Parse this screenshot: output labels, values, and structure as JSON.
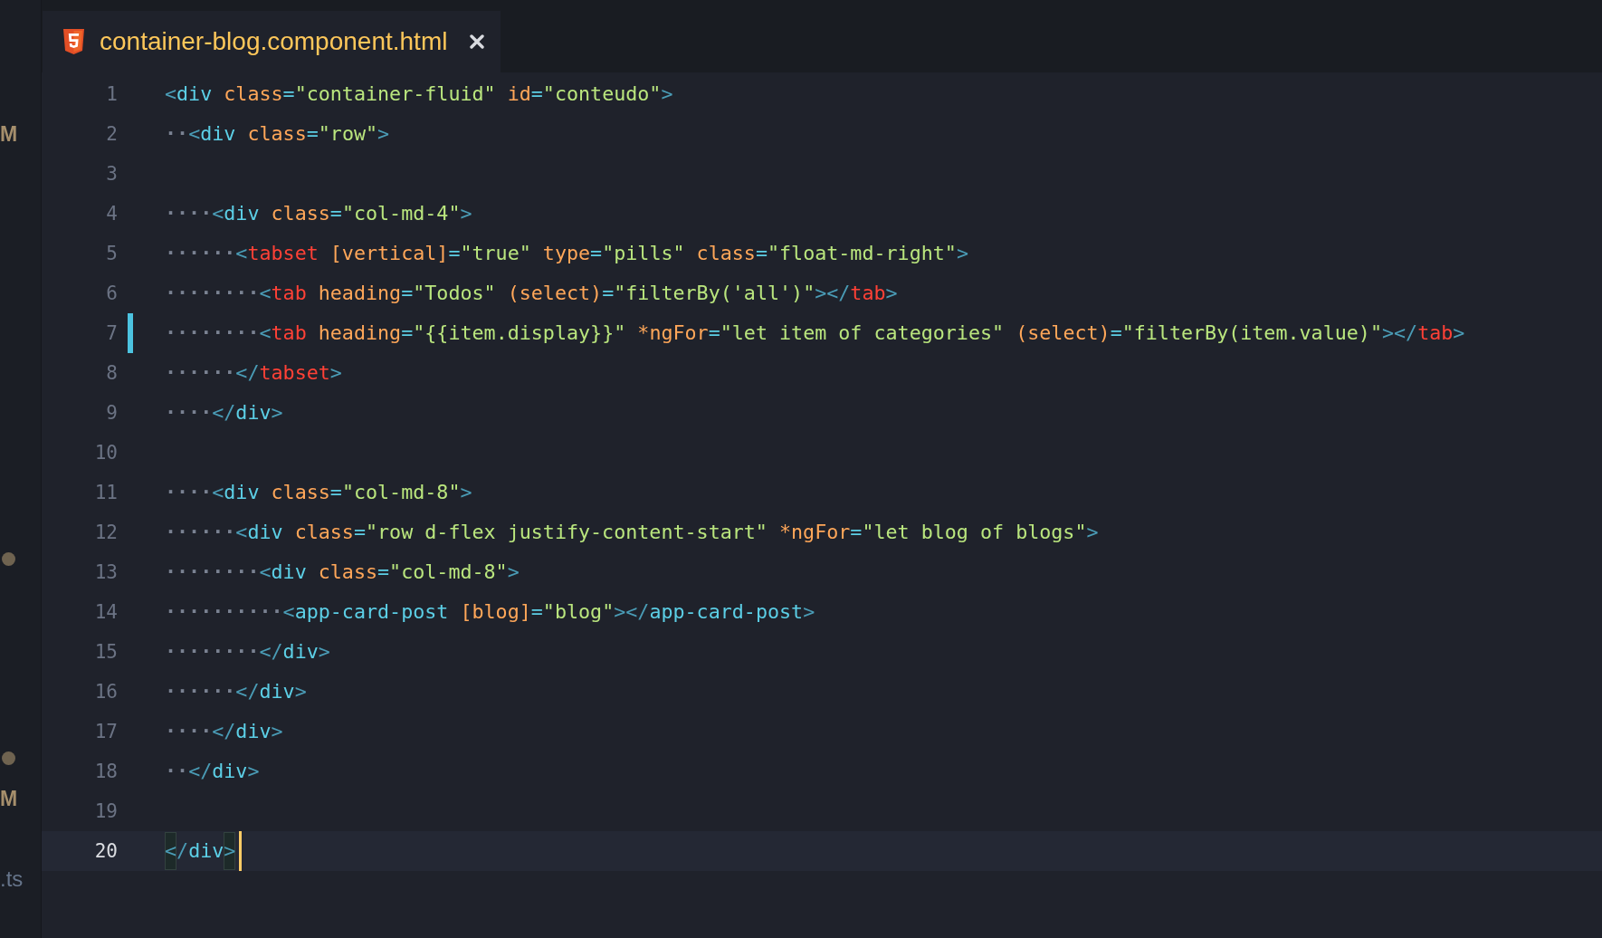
{
  "tree_view": {
    "items": [
      {
        "kind": "status",
        "text": "M"
      },
      {
        "kind": "dot"
      },
      {
        "kind": "dot"
      },
      {
        "kind": "status",
        "text": "M"
      },
      {
        "kind": "file",
        "text": ".ts"
      }
    ]
  },
  "tabs": [
    {
      "title": "container-blog.component.html",
      "selected": true
    }
  ],
  "editor": {
    "lines": [
      {
        "number": "1",
        "current": false,
        "modified": false,
        "tokens": [
          {
            "kind": "bracket",
            "text": "<"
          },
          {
            "kind": "tag",
            "text": "div"
          },
          {
            "kind": "attr",
            "text": " class"
          },
          {
            "kind": "equals",
            "text": "="
          },
          {
            "kind": "string",
            "text": "\"container-fluid\""
          },
          {
            "kind": "attr",
            "text": " id"
          },
          {
            "kind": "equals",
            "text": "="
          },
          {
            "kind": "string",
            "text": "\"conteudo\""
          },
          {
            "kind": "bracket",
            "text": ">"
          }
        ]
      },
      {
        "number": "2",
        "current": false,
        "modified": false,
        "indent": "··",
        "tokens": [
          {
            "kind": "bracket",
            "text": "<"
          },
          {
            "kind": "tag",
            "text": "div"
          },
          {
            "kind": "attr",
            "text": " class"
          },
          {
            "kind": "equals",
            "text": "="
          },
          {
            "kind": "string",
            "text": "\"row\""
          },
          {
            "kind": "bracket",
            "text": ">"
          }
        ]
      },
      {
        "number": "3",
        "current": false,
        "modified": false
      },
      {
        "number": "4",
        "current": false,
        "modified": false,
        "indent": "····",
        "tokens": [
          {
            "kind": "bracket",
            "text": "<"
          },
          {
            "kind": "tag",
            "text": "div"
          },
          {
            "kind": "attr",
            "text": " class"
          },
          {
            "kind": "equals",
            "text": "="
          },
          {
            "kind": "string",
            "text": "\"col-md-4\""
          },
          {
            "kind": "bracket",
            "text": ">"
          }
        ]
      },
      {
        "number": "5",
        "current": false,
        "modified": false,
        "indent": "······",
        "tokens": [
          {
            "kind": "bracket",
            "text": "<"
          },
          {
            "kind": "component",
            "text": "tabset"
          },
          {
            "kind": "attr",
            "text": " [vertical]"
          },
          {
            "kind": "equals",
            "text": "="
          },
          {
            "kind": "string",
            "text": "\"true\""
          },
          {
            "kind": "attr",
            "text": " type"
          },
          {
            "kind": "equals",
            "text": "="
          },
          {
            "kind": "string",
            "text": "\"pills\""
          },
          {
            "kind": "attr",
            "text": " class"
          },
          {
            "kind": "equals",
            "text": "="
          },
          {
            "kind": "string",
            "text": "\"float-md-right\""
          },
          {
            "kind": "bracket",
            "text": ">"
          }
        ]
      },
      {
        "number": "6",
        "current": false,
        "modified": false,
        "indent": "········",
        "tokens": [
          {
            "kind": "bracket",
            "text": "<"
          },
          {
            "kind": "component",
            "text": "tab"
          },
          {
            "kind": "attr",
            "text": " heading"
          },
          {
            "kind": "equals",
            "text": "="
          },
          {
            "kind": "string",
            "text": "\"Todos\""
          },
          {
            "kind": "attr",
            "text": " (select)"
          },
          {
            "kind": "equals",
            "text": "="
          },
          {
            "kind": "string",
            "text": "\"filterBy('all')\""
          },
          {
            "kind": "bracket",
            "text": "></"
          },
          {
            "kind": "component",
            "text": "tab"
          },
          {
            "kind": "bracket",
            "text": ">"
          }
        ]
      },
      {
        "number": "7",
        "current": false,
        "modified": true,
        "indent": "········",
        "tokens": [
          {
            "kind": "bracket",
            "text": "<"
          },
          {
            "kind": "component",
            "text": "tab"
          },
          {
            "kind": "attr",
            "text": " heading"
          },
          {
            "kind": "equals",
            "text": "="
          },
          {
            "kind": "string",
            "text": "\"{{item.display}}\""
          },
          {
            "kind": "attr",
            "text": " *ngFor"
          },
          {
            "kind": "equals",
            "text": "="
          },
          {
            "kind": "string",
            "text": "\"let item of categories\""
          },
          {
            "kind": "attr",
            "text": " (select)"
          },
          {
            "kind": "equals",
            "text": "="
          },
          {
            "kind": "string",
            "text": "\"filterBy(item.value)\""
          },
          {
            "kind": "bracket",
            "text": "></"
          },
          {
            "kind": "component",
            "text": "tab"
          },
          {
            "kind": "bracket",
            "text": ">"
          }
        ]
      },
      {
        "number": "8",
        "current": false,
        "modified": false,
        "indent": "······",
        "tokens": [
          {
            "kind": "bracket",
            "text": "</"
          },
          {
            "kind": "component",
            "text": "tabset"
          },
          {
            "kind": "bracket",
            "text": ">"
          }
        ]
      },
      {
        "number": "9",
        "current": false,
        "modified": false,
        "indent": "····",
        "tokens": [
          {
            "kind": "bracket",
            "text": "</"
          },
          {
            "kind": "tag",
            "text": "div"
          },
          {
            "kind": "bracket",
            "text": ">"
          }
        ]
      },
      {
        "number": "10",
        "current": false,
        "modified": false
      },
      {
        "number": "11",
        "current": false,
        "modified": false,
        "indent": "····",
        "tokens": [
          {
            "kind": "bracket",
            "text": "<"
          },
          {
            "kind": "tag",
            "text": "div"
          },
          {
            "kind": "attr",
            "text": " class"
          },
          {
            "kind": "equals",
            "text": "="
          },
          {
            "kind": "string",
            "text": "\"col-md-8\""
          },
          {
            "kind": "bracket",
            "text": ">"
          }
        ]
      },
      {
        "number": "12",
        "current": false,
        "modified": false,
        "indent": "······",
        "tokens": [
          {
            "kind": "bracket",
            "text": "<"
          },
          {
            "kind": "tag",
            "text": "div"
          },
          {
            "kind": "attr",
            "text": " class"
          },
          {
            "kind": "equals",
            "text": "="
          },
          {
            "kind": "string",
            "text": "\"row d-flex justify-content-start\""
          },
          {
            "kind": "attr",
            "text": " *ngFor"
          },
          {
            "kind": "equals",
            "text": "="
          },
          {
            "kind": "string",
            "text": "\"let blog of blogs\""
          },
          {
            "kind": "bracket",
            "text": ">"
          }
        ]
      },
      {
        "number": "13",
        "current": false,
        "modified": false,
        "indent": "········",
        "tokens": [
          {
            "kind": "bracket",
            "text": "<"
          },
          {
            "kind": "tag",
            "text": "div"
          },
          {
            "kind": "attr",
            "text": " class"
          },
          {
            "kind": "equals",
            "text": "="
          },
          {
            "kind": "string",
            "text": "\"col-md-8\""
          },
          {
            "kind": "bracket",
            "text": ">"
          }
        ]
      },
      {
        "number": "14",
        "current": false,
        "modified": false,
        "indent": "··········",
        "tokens": [
          {
            "kind": "bracket",
            "text": "<"
          },
          {
            "kind": "tag",
            "text": "app-card-post"
          },
          {
            "kind": "attr",
            "text": " [blog]"
          },
          {
            "kind": "equals",
            "text": "="
          },
          {
            "kind": "string",
            "text": "\"blog\""
          },
          {
            "kind": "bracket",
            "text": "></"
          },
          {
            "kind": "tag",
            "text": "app-card-post"
          },
          {
            "kind": "bracket",
            "text": ">"
          }
        ]
      },
      {
        "number": "15",
        "current": false,
        "modified": false,
        "indent": "········",
        "tokens": [
          {
            "kind": "bracket",
            "text": "</"
          },
          {
            "kind": "tag",
            "text": "div"
          },
          {
            "kind": "bracket",
            "text": ">"
          }
        ]
      },
      {
        "number": "16",
        "current": false,
        "modified": false,
        "indent": "······",
        "tokens": [
          {
            "kind": "bracket",
            "text": "</"
          },
          {
            "kind": "tag",
            "text": "div"
          },
          {
            "kind": "bracket",
            "text": ">"
          }
        ]
      },
      {
        "number": "17",
        "current": false,
        "modified": false,
        "indent": "····",
        "tokens": [
          {
            "kind": "bracket",
            "text": "</"
          },
          {
            "kind": "tag",
            "text": "div"
          },
          {
            "kind": "bracket",
            "text": ">"
          }
        ]
      },
      {
        "number": "18",
        "current": false,
        "modified": false,
        "indent": "··",
        "tokens": [
          {
            "kind": "bracket",
            "text": "</"
          },
          {
            "kind": "tag",
            "text": "div"
          },
          {
            "kind": "bracket",
            "text": ">"
          }
        ]
      },
      {
        "number": "19",
        "current": false,
        "modified": false
      },
      {
        "number": "20",
        "current": true,
        "modified": false,
        "tokens": [
          {
            "kind": "bracket",
            "text": "<"
          },
          {
            "kind": "bracket",
            "text": "/"
          },
          {
            "kind": "tag",
            "text": "div"
          },
          {
            "kind": "bracket",
            "text": ">"
          }
        ]
      }
    ]
  }
}
